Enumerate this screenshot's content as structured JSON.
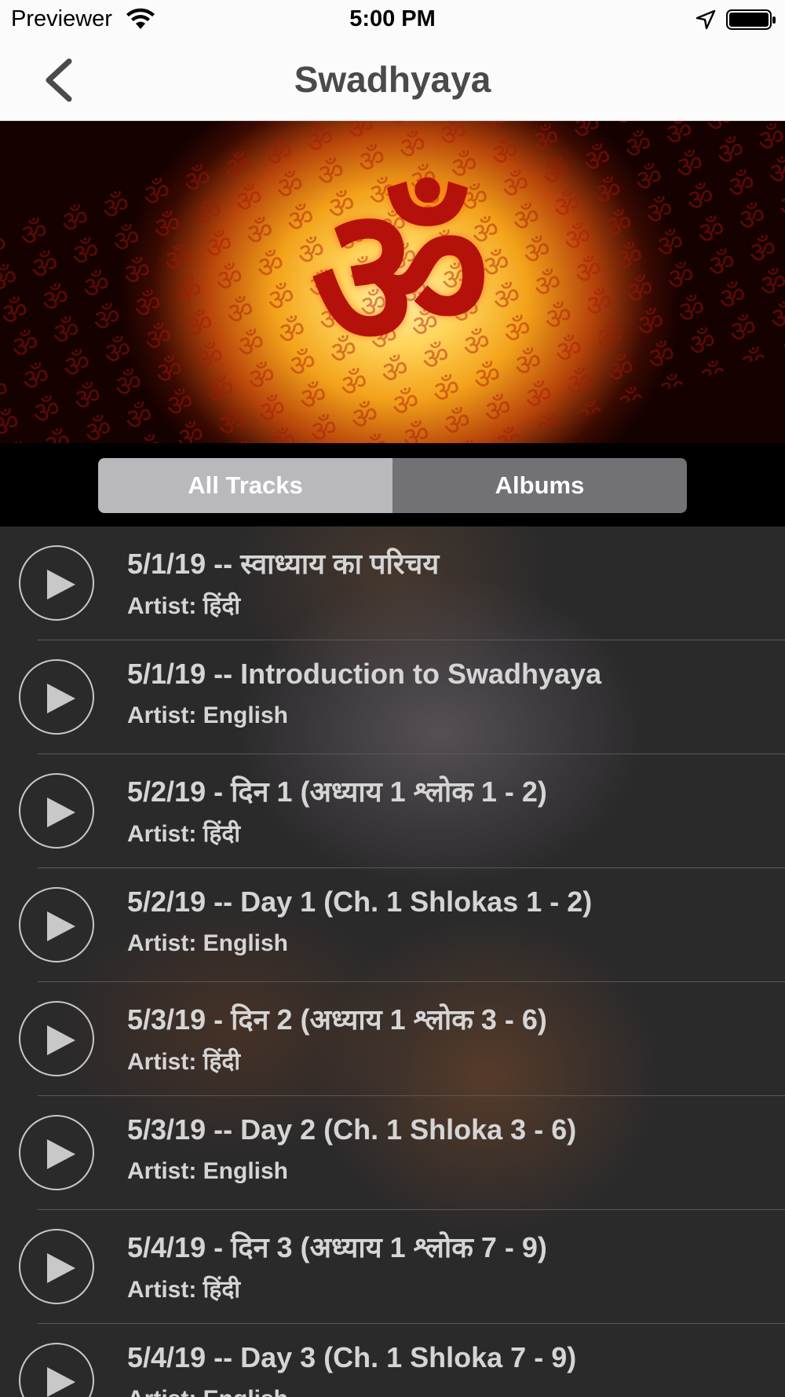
{
  "status_bar": {
    "carrier": "Previewer",
    "time": "5:00 PM",
    "icons": [
      "wifi-icon",
      "location-icon",
      "battery-icon"
    ]
  },
  "nav": {
    "title": "Swadhyaya",
    "back_icon": "chevron-left-icon"
  },
  "banner": {
    "symbol": "ॐ",
    "pattern_glyph": "ॐ"
  },
  "segments": {
    "all_tracks": "All Tracks",
    "albums": "Albums",
    "selected": "All Tracks"
  },
  "tracks": [
    {
      "title": "5/1/19 -- स्वाध्याय का परिचय",
      "artist": "Artist: हिंदी"
    },
    {
      "title": "5/1/19 -- Introduction to Swadhyaya",
      "artist": "Artist: English"
    },
    {
      "title": "5/2/19 - दिन 1 (अध्याय 1 श्लोक 1 - 2)",
      "artist": "Artist: हिंदी"
    },
    {
      "title": "5/2/19 -- Day 1 (Ch. 1 Shlokas 1 - 2)",
      "artist": "Artist: English"
    },
    {
      "title": "5/3/19 - दिन 2 (अध्याय 1 श्लोक 3 - 6)",
      "artist": "Artist: हिंदी"
    },
    {
      "title": "5/3/19 -- Day 2 (Ch. 1 Shloka 3 - 6)",
      "artist": "Artist: English"
    },
    {
      "title": "5/4/19 - दिन 3 (अध्याय 1 श्लोक 7 - 9)",
      "artist": "Artist: हिंदी"
    },
    {
      "title": "5/4/19 -- Day 3 (Ch. 1 Shloka 7 - 9)",
      "artist": "Artist: English"
    }
  ],
  "colors": {
    "nav_title": "#4a4a4a",
    "segment_selected": "#b9b8bd",
    "segment_unselected": "#727176",
    "track_text": "#d5d5d5",
    "list_background": "#2b2a2b"
  }
}
